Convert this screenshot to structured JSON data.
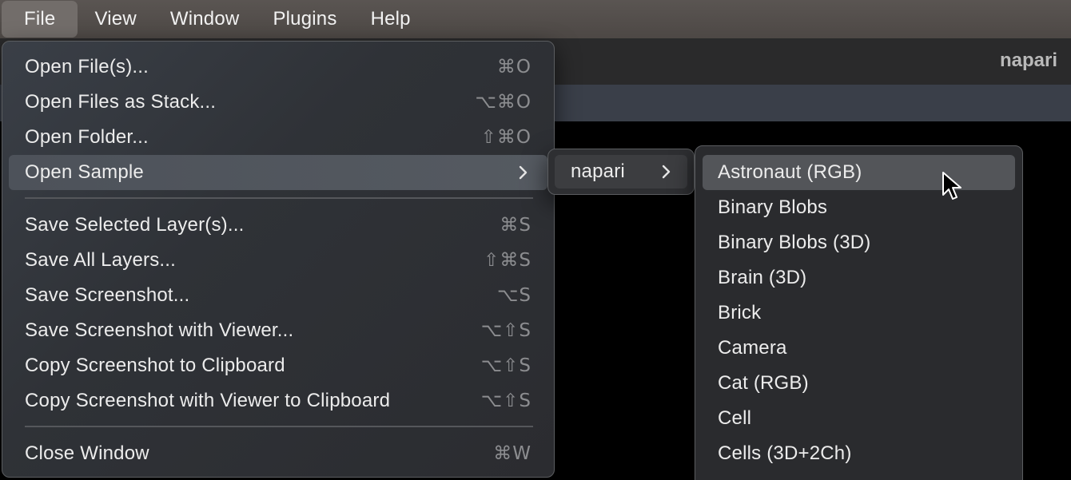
{
  "menubar": {
    "items": [
      {
        "label": "File"
      },
      {
        "label": "View"
      },
      {
        "label": "Window"
      },
      {
        "label": "Plugins"
      },
      {
        "label": "Help"
      }
    ]
  },
  "window": {
    "title": "napari"
  },
  "file_menu": {
    "items": [
      {
        "label": "Open File(s)...",
        "shortcut": "⌘O"
      },
      {
        "label": "Open Files as Stack...",
        "shortcut": "⌥⌘O"
      },
      {
        "label": "Open Folder...",
        "shortcut": "⇧⌘O"
      },
      {
        "label": "Open Sample",
        "shortcut": ""
      },
      {
        "label": "Save Selected Layer(s)...",
        "shortcut": "⌘S"
      },
      {
        "label": "Save All Layers...",
        "shortcut": "⇧⌘S"
      },
      {
        "label": "Save Screenshot...",
        "shortcut": "⌥S"
      },
      {
        "label": "Save Screenshot with Viewer...",
        "shortcut": "⌥⇧S"
      },
      {
        "label": "Copy Screenshot to Clipboard",
        "shortcut": "⌥⇧S"
      },
      {
        "label": "Copy Screenshot with Viewer to Clipboard",
        "shortcut": "⌥⇧S"
      },
      {
        "label": "Close Window",
        "shortcut": "⌘W"
      }
    ]
  },
  "sample_submenu": {
    "label": "napari"
  },
  "samples_menu": {
    "items": [
      {
        "label": "Astronaut (RGB)"
      },
      {
        "label": "Binary Blobs"
      },
      {
        "label": "Binary Blobs (3D)"
      },
      {
        "label": "Brain (3D)"
      },
      {
        "label": "Brick"
      },
      {
        "label": "Camera"
      },
      {
        "label": "Cat (RGB)"
      },
      {
        "label": "Cell"
      },
      {
        "label": "Cells (3D+2Ch)"
      }
    ]
  },
  "colors": {
    "menubar": "#56514e",
    "menu_bg": "#2c2e32",
    "highlight": "#535559",
    "text": "#ececec",
    "shortcut_text": "#8c8d90"
  }
}
